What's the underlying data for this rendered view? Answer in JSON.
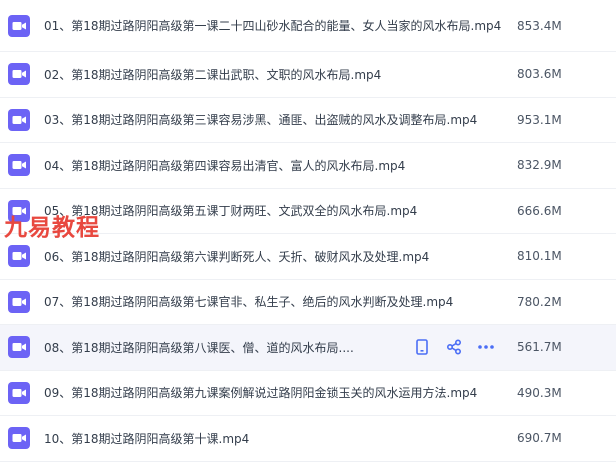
{
  "colors": {
    "icon": "#6c63f5",
    "action": "#4b6ef5",
    "watermark": "#e8483f"
  },
  "files": [
    {
      "name": "01、第18期过路阴阳高级第一课二十四山砂水配合的能量、女人当家的风水布局.mp4",
      "size": "853.4M"
    },
    {
      "name": "02、第18期过路阴阳高级第二课出武职、文职的风水布局.mp4",
      "size": "803.6M"
    },
    {
      "name": "03、第18期过路阴阳高级第三课容易涉黑、通匪、出盗贼的风水及调整布局.mp4",
      "size": "953.1M"
    },
    {
      "name": "04、第18期过路阴阳高级第四课容易出清官、富人的风水布局.mp4",
      "size": "832.9M"
    },
    {
      "name": "05、第18期过路阴阳高级第五课丁财两旺、文武双全的风水布局.mp4",
      "size": "666.6M"
    },
    {
      "name": "06、第18期过路阴阳高级第六课判断死人、夭折、破财风水及处理.mp4",
      "size": "810.1M"
    },
    {
      "name": "07、第18期过路阴阳高级第七课官非、私生子、绝后的风水判断及处理.mp4",
      "size": "780.2M"
    },
    {
      "name": "08、第18期过路阴阳高级第八课医、僧、道的风水布局....",
      "size": "561.7M"
    },
    {
      "name": "09、第18期过路阴阳高级第九课案例解说过路阴阳金锁玉关的风水运用方法.mp4",
      "size": "490.3M"
    },
    {
      "name": "10、第18期过路阴阳高级第十课.mp4",
      "size": "690.7M"
    }
  ],
  "watermark": "九易教程"
}
